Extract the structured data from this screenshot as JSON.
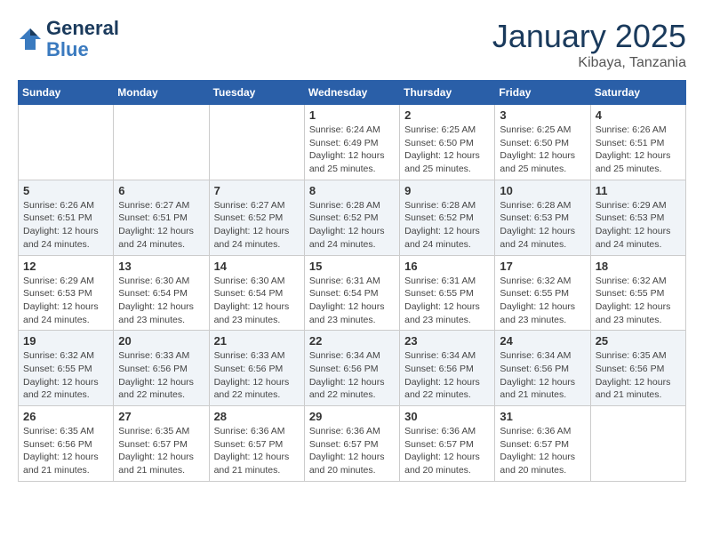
{
  "header": {
    "logo_line1": "General",
    "logo_line2": "Blue",
    "month_title": "January 2025",
    "location": "Kibaya, Tanzania"
  },
  "weekdays": [
    "Sunday",
    "Monday",
    "Tuesday",
    "Wednesday",
    "Thursday",
    "Friday",
    "Saturday"
  ],
  "weeks": [
    [
      {
        "day": "",
        "sunrise": "",
        "sunset": "",
        "daylight": ""
      },
      {
        "day": "",
        "sunrise": "",
        "sunset": "",
        "daylight": ""
      },
      {
        "day": "",
        "sunrise": "",
        "sunset": "",
        "daylight": ""
      },
      {
        "day": "1",
        "sunrise": "Sunrise: 6:24 AM",
        "sunset": "Sunset: 6:49 PM",
        "daylight": "Daylight: 12 hours and 25 minutes."
      },
      {
        "day": "2",
        "sunrise": "Sunrise: 6:25 AM",
        "sunset": "Sunset: 6:50 PM",
        "daylight": "Daylight: 12 hours and 25 minutes."
      },
      {
        "day": "3",
        "sunrise": "Sunrise: 6:25 AM",
        "sunset": "Sunset: 6:50 PM",
        "daylight": "Daylight: 12 hours and 25 minutes."
      },
      {
        "day": "4",
        "sunrise": "Sunrise: 6:26 AM",
        "sunset": "Sunset: 6:51 PM",
        "daylight": "Daylight: 12 hours and 25 minutes."
      }
    ],
    [
      {
        "day": "5",
        "sunrise": "Sunrise: 6:26 AM",
        "sunset": "Sunset: 6:51 PM",
        "daylight": "Daylight: 12 hours and 24 minutes."
      },
      {
        "day": "6",
        "sunrise": "Sunrise: 6:27 AM",
        "sunset": "Sunset: 6:51 PM",
        "daylight": "Daylight: 12 hours and 24 minutes."
      },
      {
        "day": "7",
        "sunrise": "Sunrise: 6:27 AM",
        "sunset": "Sunset: 6:52 PM",
        "daylight": "Daylight: 12 hours and 24 minutes."
      },
      {
        "day": "8",
        "sunrise": "Sunrise: 6:28 AM",
        "sunset": "Sunset: 6:52 PM",
        "daylight": "Daylight: 12 hours and 24 minutes."
      },
      {
        "day": "9",
        "sunrise": "Sunrise: 6:28 AM",
        "sunset": "Sunset: 6:52 PM",
        "daylight": "Daylight: 12 hours and 24 minutes."
      },
      {
        "day": "10",
        "sunrise": "Sunrise: 6:28 AM",
        "sunset": "Sunset: 6:53 PM",
        "daylight": "Daylight: 12 hours and 24 minutes."
      },
      {
        "day": "11",
        "sunrise": "Sunrise: 6:29 AM",
        "sunset": "Sunset: 6:53 PM",
        "daylight": "Daylight: 12 hours and 24 minutes."
      }
    ],
    [
      {
        "day": "12",
        "sunrise": "Sunrise: 6:29 AM",
        "sunset": "Sunset: 6:53 PM",
        "daylight": "Daylight: 12 hours and 24 minutes."
      },
      {
        "day": "13",
        "sunrise": "Sunrise: 6:30 AM",
        "sunset": "Sunset: 6:54 PM",
        "daylight": "Daylight: 12 hours and 23 minutes."
      },
      {
        "day": "14",
        "sunrise": "Sunrise: 6:30 AM",
        "sunset": "Sunset: 6:54 PM",
        "daylight": "Daylight: 12 hours and 23 minutes."
      },
      {
        "day": "15",
        "sunrise": "Sunrise: 6:31 AM",
        "sunset": "Sunset: 6:54 PM",
        "daylight": "Daylight: 12 hours and 23 minutes."
      },
      {
        "day": "16",
        "sunrise": "Sunrise: 6:31 AM",
        "sunset": "Sunset: 6:55 PM",
        "daylight": "Daylight: 12 hours and 23 minutes."
      },
      {
        "day": "17",
        "sunrise": "Sunrise: 6:32 AM",
        "sunset": "Sunset: 6:55 PM",
        "daylight": "Daylight: 12 hours and 23 minutes."
      },
      {
        "day": "18",
        "sunrise": "Sunrise: 6:32 AM",
        "sunset": "Sunset: 6:55 PM",
        "daylight": "Daylight: 12 hours and 23 minutes."
      }
    ],
    [
      {
        "day": "19",
        "sunrise": "Sunrise: 6:32 AM",
        "sunset": "Sunset: 6:55 PM",
        "daylight": "Daylight: 12 hours and 22 minutes."
      },
      {
        "day": "20",
        "sunrise": "Sunrise: 6:33 AM",
        "sunset": "Sunset: 6:56 PM",
        "daylight": "Daylight: 12 hours and 22 minutes."
      },
      {
        "day": "21",
        "sunrise": "Sunrise: 6:33 AM",
        "sunset": "Sunset: 6:56 PM",
        "daylight": "Daylight: 12 hours and 22 minutes."
      },
      {
        "day": "22",
        "sunrise": "Sunrise: 6:34 AM",
        "sunset": "Sunset: 6:56 PM",
        "daylight": "Daylight: 12 hours and 22 minutes."
      },
      {
        "day": "23",
        "sunrise": "Sunrise: 6:34 AM",
        "sunset": "Sunset: 6:56 PM",
        "daylight": "Daylight: 12 hours and 22 minutes."
      },
      {
        "day": "24",
        "sunrise": "Sunrise: 6:34 AM",
        "sunset": "Sunset: 6:56 PM",
        "daylight": "Daylight: 12 hours and 21 minutes."
      },
      {
        "day": "25",
        "sunrise": "Sunrise: 6:35 AM",
        "sunset": "Sunset: 6:56 PM",
        "daylight": "Daylight: 12 hours and 21 minutes."
      }
    ],
    [
      {
        "day": "26",
        "sunrise": "Sunrise: 6:35 AM",
        "sunset": "Sunset: 6:56 PM",
        "daylight": "Daylight: 12 hours and 21 minutes."
      },
      {
        "day": "27",
        "sunrise": "Sunrise: 6:35 AM",
        "sunset": "Sunset: 6:57 PM",
        "daylight": "Daylight: 12 hours and 21 minutes."
      },
      {
        "day": "28",
        "sunrise": "Sunrise: 6:36 AM",
        "sunset": "Sunset: 6:57 PM",
        "daylight": "Daylight: 12 hours and 21 minutes."
      },
      {
        "day": "29",
        "sunrise": "Sunrise: 6:36 AM",
        "sunset": "Sunset: 6:57 PM",
        "daylight": "Daylight: 12 hours and 20 minutes."
      },
      {
        "day": "30",
        "sunrise": "Sunrise: 6:36 AM",
        "sunset": "Sunset: 6:57 PM",
        "daylight": "Daylight: 12 hours and 20 minutes."
      },
      {
        "day": "31",
        "sunrise": "Sunrise: 6:36 AM",
        "sunset": "Sunset: 6:57 PM",
        "daylight": "Daylight: 12 hours and 20 minutes."
      },
      {
        "day": "",
        "sunrise": "",
        "sunset": "",
        "daylight": ""
      }
    ]
  ]
}
